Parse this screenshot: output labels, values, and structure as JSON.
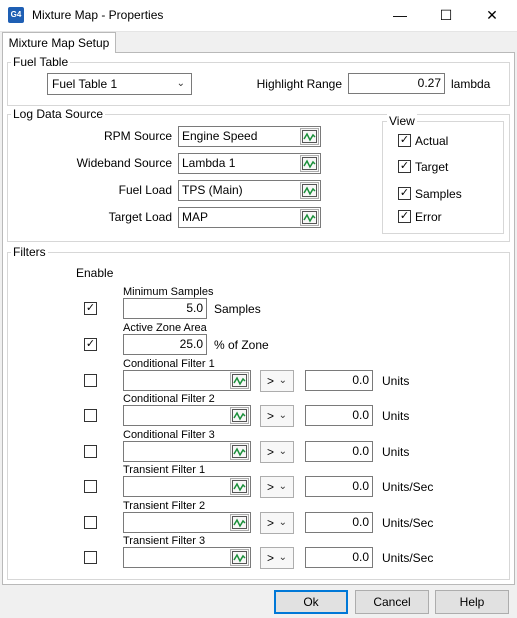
{
  "window": {
    "title": "Mixture Map - Properties",
    "minimize_glyph": "—",
    "maximize_glyph": "☐",
    "close_glyph": "✕",
    "icon": "app-logo-icon",
    "icon_text": "G4"
  },
  "tab": {
    "label": "Mixture Map Setup"
  },
  "fuel_table": {
    "group_label": "Fuel Table",
    "selected": "Fuel Table 1",
    "highlight_label": "Highlight Range",
    "highlight_value": "0.27",
    "highlight_unit": "lambda"
  },
  "log_source": {
    "group_label": "Log Data Source",
    "rows": [
      {
        "label": "RPM Source",
        "value": "Engine Speed"
      },
      {
        "label": "Wideband Source",
        "value": "Lambda 1"
      },
      {
        "label": "Fuel Load",
        "value": "TPS (Main)"
      },
      {
        "label": "Target Load",
        "value": "MAP"
      }
    ]
  },
  "view": {
    "group_label": "View",
    "items": [
      {
        "label": "Actual",
        "checked": true
      },
      {
        "label": "Target",
        "checked": true
      },
      {
        "label": "Samples",
        "checked": true
      },
      {
        "label": "Error",
        "checked": true
      }
    ]
  },
  "filters": {
    "group_label": "Filters",
    "enable_label": "Enable",
    "min_samples": {
      "label": "Minimum Samples",
      "value": "5.0",
      "unit": "Samples",
      "enabled": true
    },
    "active_zone": {
      "label": "Active Zone Area",
      "value": "25.0",
      "unit": "% of Zone",
      "enabled": true
    },
    "conditional": [
      {
        "label": "Conditional Filter 1",
        "source": "",
        "op": ">",
        "value": "0.0",
        "unit": "Units",
        "enabled": false
      },
      {
        "label": "Conditional Filter 2",
        "source": "",
        "op": ">",
        "value": "0.0",
        "unit": "Units",
        "enabled": false
      },
      {
        "label": "Conditional Filter 3",
        "source": "",
        "op": ">",
        "value": "0.0",
        "unit": "Units",
        "enabled": false
      },
      {
        "label": "Transient Filter 1",
        "source": "",
        "op": ">",
        "value": "0.0",
        "unit": "Units/Sec",
        "enabled": false
      },
      {
        "label": "Transient Filter 2",
        "source": "",
        "op": ">",
        "value": "0.0",
        "unit": "Units/Sec",
        "enabled": false
      },
      {
        "label": "Transient Filter 3",
        "source": "",
        "op": ">",
        "value": "0.0",
        "unit": "Units/Sec",
        "enabled": false
      }
    ]
  },
  "buttons": {
    "ok": "Ok",
    "cancel": "Cancel",
    "help": "Help"
  },
  "colors": {
    "default_button_border": "#0078d7",
    "source_icon": "#1a8f3a"
  }
}
